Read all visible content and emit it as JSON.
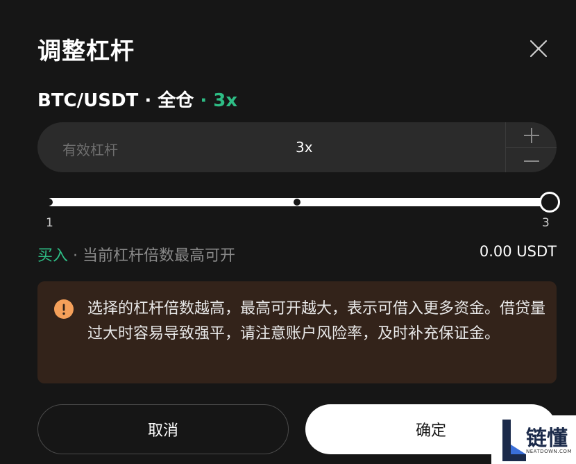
{
  "dialog": {
    "title": "调整杠杆",
    "close_icon": "close-icon"
  },
  "pair": {
    "symbol": "BTC/USDT",
    "sep1": " · ",
    "margin_mode": "全仓",
    "leverage_text": " · 3x"
  },
  "leverage_input": {
    "label": "有效杠杆",
    "value": "3x",
    "plus_icon": "plus-icon",
    "minus_icon": "minus-icon"
  },
  "slider": {
    "min_label": "1",
    "max_label": "3",
    "value": 3,
    "min": 1,
    "max": 3,
    "marks": [
      1,
      2,
      3
    ]
  },
  "available": {
    "side": "买入",
    "description": " · 当前杠杆倍数最高可开",
    "amount": "0.00 USDT"
  },
  "warning": {
    "icon": "warning-icon",
    "text": "选择的杠杆倍数越高，最高可开越大，表示可借入更多资金。借贷量过大时容易导致强平，请注意账户风险率，及时补充保证金。"
  },
  "buttons": {
    "cancel": "取消",
    "confirm": "确定"
  },
  "watermark": {
    "brand_cn": "链懂",
    "brand_en": "NEATDOWN.COM"
  },
  "colors": {
    "background": "#161616",
    "accent_green": "#2ebd85",
    "warning_orange": "#f5a05a",
    "warning_bg": "#33231a"
  }
}
